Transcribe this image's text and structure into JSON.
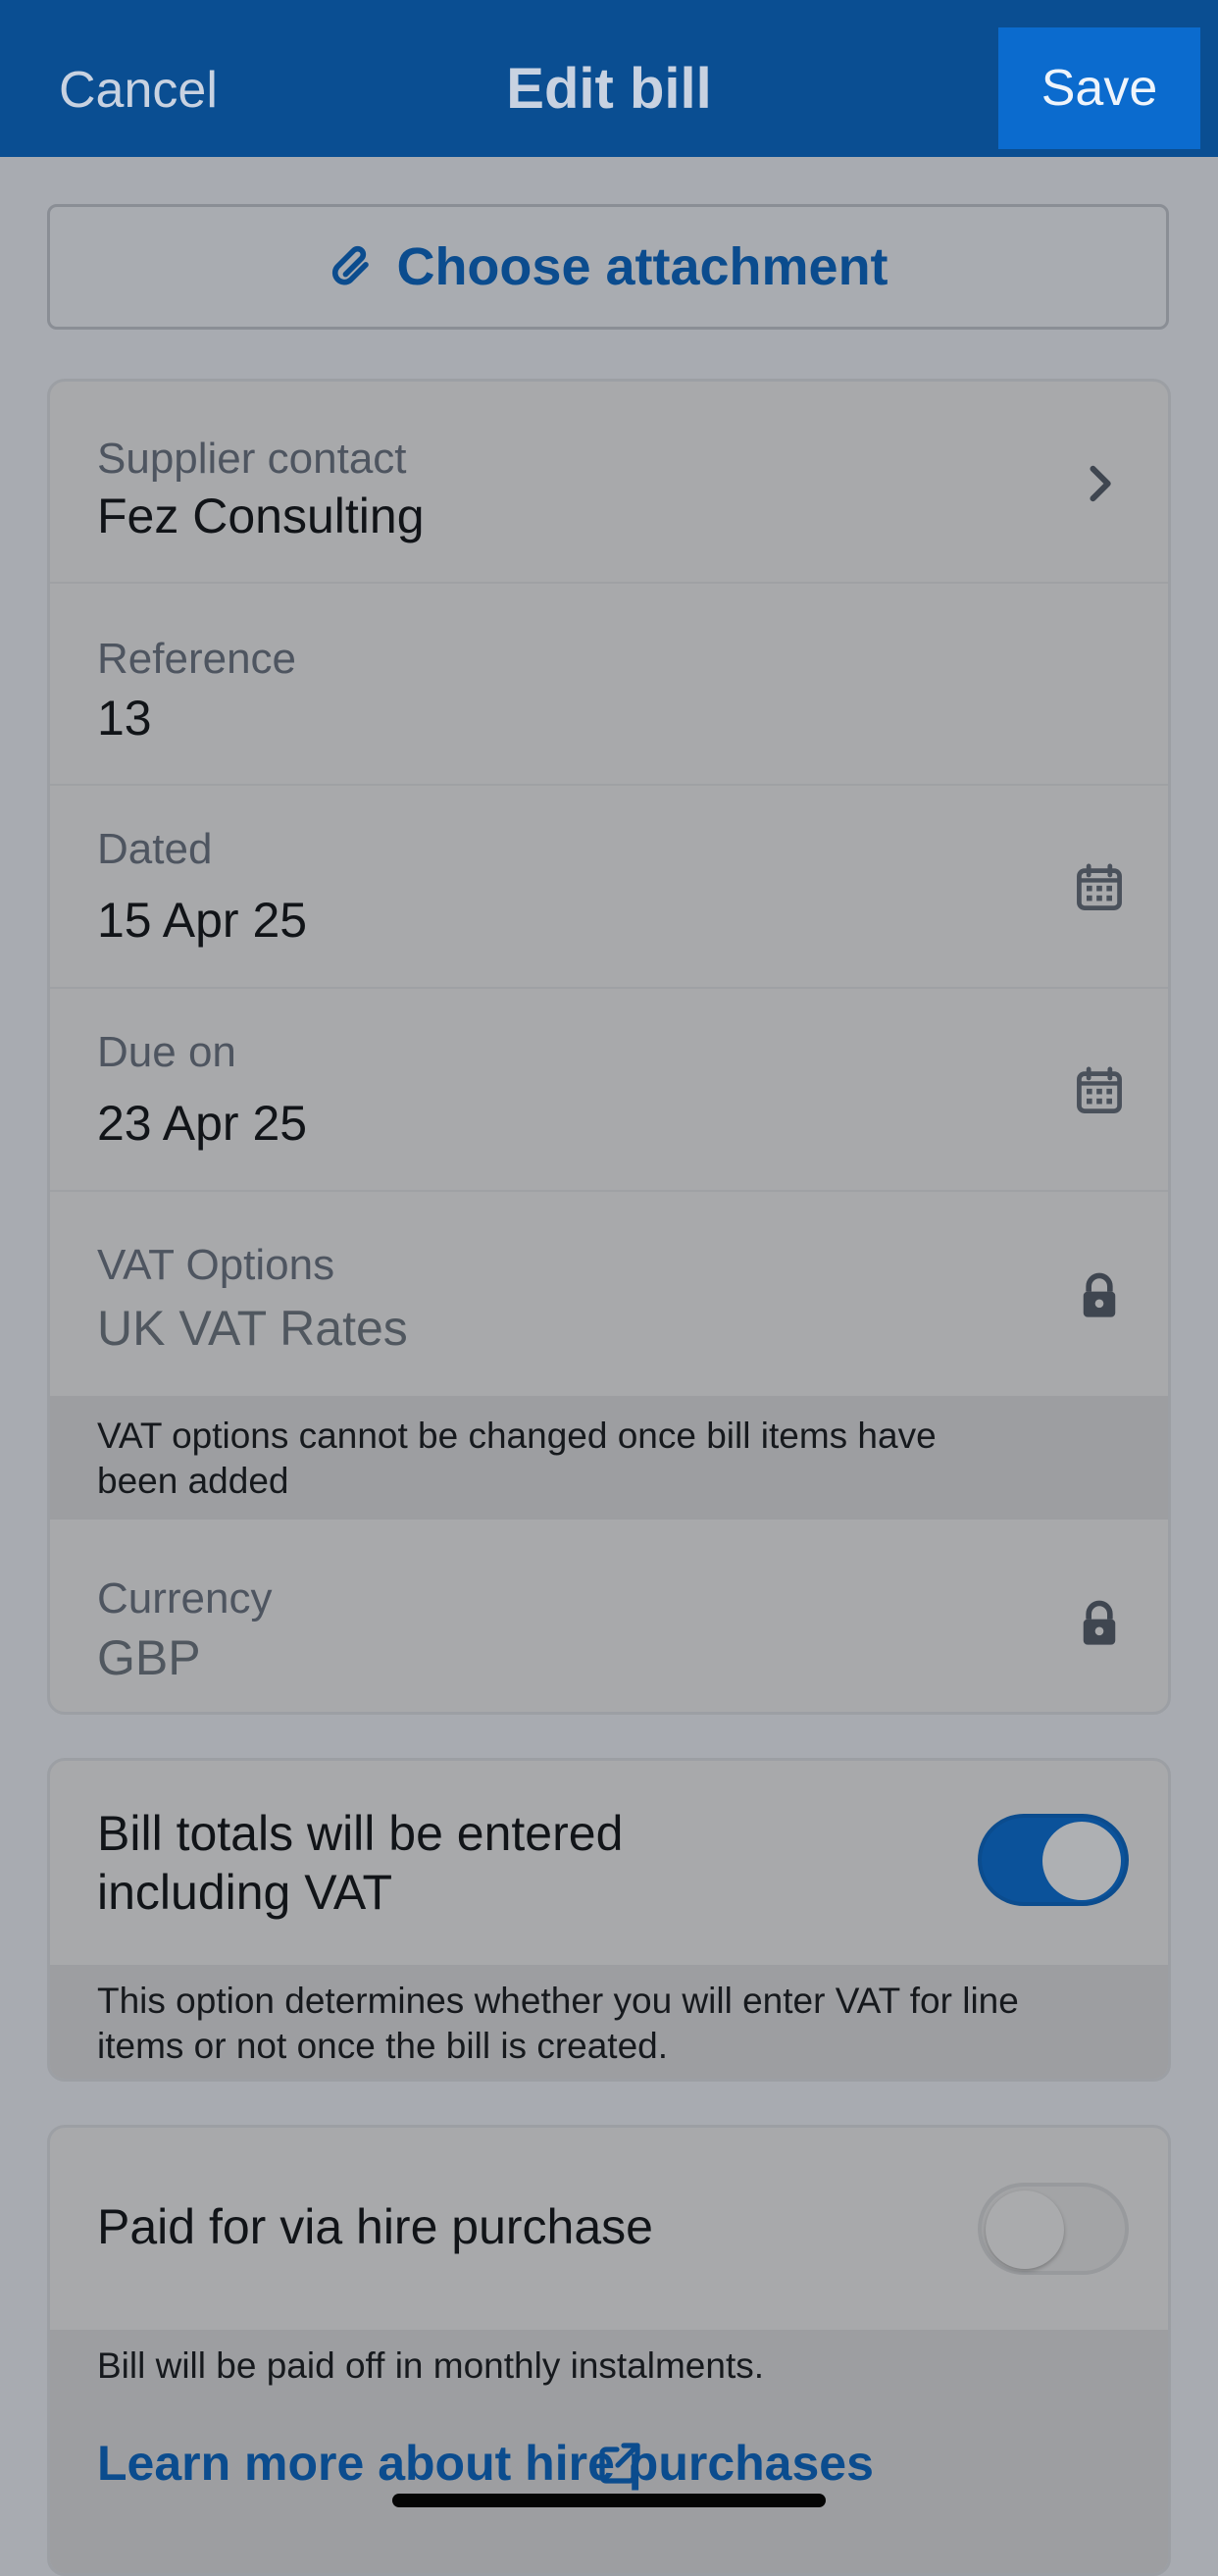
{
  "header": {
    "cancel_label": "Cancel",
    "title": "Edit bill",
    "save_label": "Save"
  },
  "attachment": {
    "label": "Choose attachment",
    "icon": "paperclip-icon"
  },
  "fields": {
    "supplier": {
      "label": "Supplier contact",
      "value": "Fez Consulting",
      "icon": "chevron-right-icon"
    },
    "reference": {
      "label": "Reference",
      "value": "13"
    },
    "dated": {
      "label": "Dated",
      "value": "15 Apr 25",
      "icon": "calendar-icon"
    },
    "due_on": {
      "label": "Due on",
      "value": "23 Apr 25",
      "icon": "calendar-icon"
    },
    "vat_options": {
      "label": "VAT Options",
      "value": "UK VAT Rates",
      "icon": "lock-icon",
      "note": "VAT options cannot be changed once bill items have been added"
    },
    "currency": {
      "label": "Currency",
      "value": "GBP",
      "icon": "lock-icon"
    }
  },
  "vat_inclusive": {
    "label": "Bill totals will be entered including VAT",
    "enabled": true,
    "note": "This option determines whether you will enter VAT for line items or not once the bill is created."
  },
  "hire_purchase": {
    "label": "Paid for via hire purchase",
    "enabled": false,
    "note": "Bill will be paid off in monthly instalments.",
    "link_label": "Learn more about hire purchases",
    "link_icon": "external-link-icon"
  },
  "colors": {
    "header_bg": "#0a4e92",
    "save_bg": "#0b6bce",
    "accent": "#0b4c8e"
  }
}
